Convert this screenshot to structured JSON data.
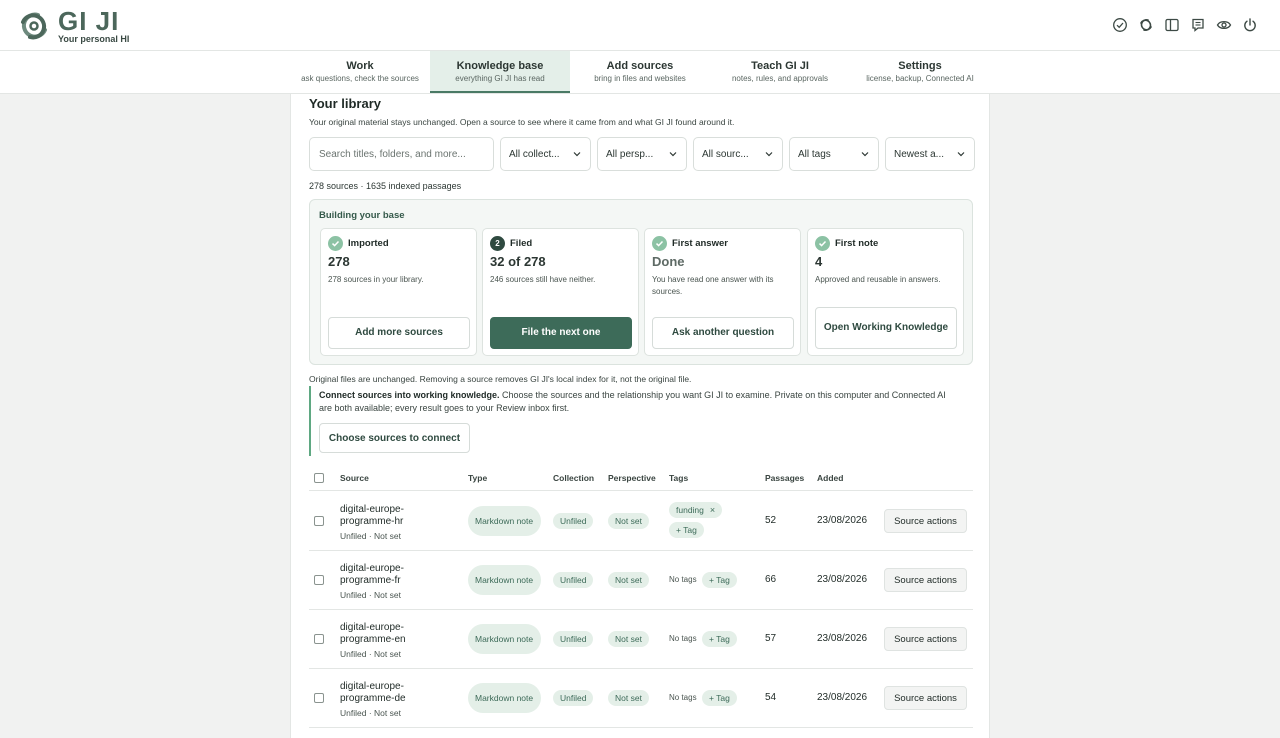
{
  "app": {
    "name": "GI JI",
    "tagline": "Your personal HI",
    "accent": "#4c675b"
  },
  "top_icons": [
    "check-circle-icon",
    "logo-swirl-icon",
    "sidebar-panel-icon",
    "note-icon",
    "eye-icon",
    "power-icon"
  ],
  "nav": {
    "tabs": [
      {
        "label": "Work",
        "sub": "ask questions, check the sources"
      },
      {
        "label": "Knowledge base",
        "sub": "everything GI JI has read",
        "active": true
      },
      {
        "label": "Add sources",
        "sub": "bring in files and websites"
      },
      {
        "label": "Teach GI JI",
        "sub": "notes, rules, and approvals"
      },
      {
        "label": "Settings",
        "sub": "license, backup, Connected AI"
      }
    ]
  },
  "library": {
    "title": "Your library",
    "subtitle": "Your original material stays unchanged. Open a source to see where it came from and what GI JI found around it.",
    "search_placeholder": "Search titles, folders, and more...",
    "filters": [
      "All collect...",
      "All persp...",
      "All sourc...",
      "All tags",
      "Newest a..."
    ],
    "count": "278 sources · 1635 indexed passages"
  },
  "building": {
    "title": "Building your base",
    "cards": [
      {
        "badge": "check",
        "head": "Imported",
        "value": "278",
        "desc": "278 sources in your library.",
        "button": "Add more sources"
      },
      {
        "badge": "2",
        "head": "Filed",
        "value": "32 of 278",
        "desc": "246 sources still have neither.",
        "button": "File the next one"
      },
      {
        "badge": "check",
        "head": "First answer",
        "value": "Done",
        "desc": "You have read one answer with its sources.",
        "button": "Ask another question"
      },
      {
        "badge": "check",
        "head": "First note",
        "value": "4",
        "desc": "Approved and reusable in answers.",
        "button": "Open Working Knowledge"
      }
    ]
  },
  "original_note": "Original files are unchanged. Removing a source removes GI JI's local index for it, not the original file.",
  "connect": {
    "bold": "Connect sources into working knowledge.",
    "text": " Choose the sources and the relationship you want GI JI to examine. Private on this computer and Connected AI are both available; every result goes to your Review inbox first.",
    "button": "Choose sources to connect"
  },
  "table": {
    "headers": [
      "Source",
      "Type",
      "Collection",
      "Perspective",
      "Tags",
      "Passages",
      "Added"
    ],
    "rows": [
      {
        "name": "digital-europe-programme-hr",
        "meta": "Unfiled · Not set",
        "type": "Markdown note",
        "collection": "Unfiled",
        "perspective": "Not set",
        "tags": [
          "funding"
        ],
        "add_tag": "+ Tag",
        "no_tags": "",
        "passages": "52",
        "added": "23/08/2026",
        "action": "Source actions"
      },
      {
        "name": "digital-europe-programme-fr",
        "meta": "Unfiled · Not set",
        "type": "Markdown note",
        "collection": "Unfiled",
        "perspective": "Not set",
        "tags": [],
        "add_tag": "+ Tag",
        "no_tags": "No tags",
        "passages": "66",
        "added": "23/08/2026",
        "action": "Source actions"
      },
      {
        "name": "digital-europe-programme-en",
        "meta": "Unfiled · Not set",
        "type": "Markdown note",
        "collection": "Unfiled",
        "perspective": "Not set",
        "tags": [],
        "add_tag": "+ Tag",
        "no_tags": "No tags",
        "passages": "57",
        "added": "23/08/2026",
        "action": "Source actions"
      },
      {
        "name": "digital-europe-programme-de",
        "meta": "Unfiled · Not set",
        "type": "Markdown note",
        "collection": "Unfiled",
        "perspective": "Not set",
        "tags": [],
        "add_tag": "+ Tag",
        "no_tags": "No tags",
        "passages": "54",
        "added": "23/08/2026",
        "action": "Source actions"
      }
    ]
  }
}
